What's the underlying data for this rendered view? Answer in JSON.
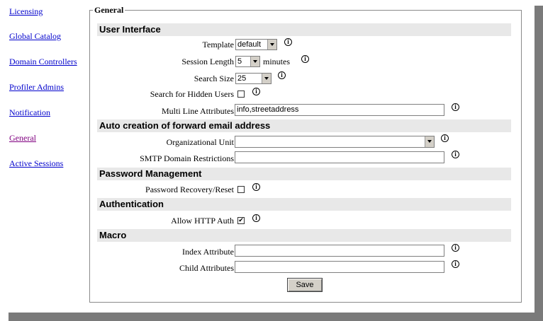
{
  "nav": {
    "items": [
      {
        "label": "Licensing"
      },
      {
        "label": "Global Catalog"
      },
      {
        "label": "Domain Controllers"
      },
      {
        "label": "Profiler Admins"
      },
      {
        "label": "Notification"
      },
      {
        "label": "General"
      },
      {
        "label": "Active Sessions"
      }
    ]
  },
  "form": {
    "legend": "General",
    "info_icon": "i",
    "sections": {
      "user_interface": "User Interface",
      "auto_email": "Auto creation of forward email address",
      "password": "Password Management",
      "auth": "Authentication",
      "macro": "Macro"
    },
    "template": {
      "label": "Template",
      "value": "default"
    },
    "session_length": {
      "label": "Session Length",
      "value": "5",
      "unit": "minutes"
    },
    "search_size": {
      "label": "Search Size",
      "value": "25"
    },
    "hidden_users": {
      "label": "Search for Hidden Users",
      "checked": false
    },
    "multi_line": {
      "label": "Multi Line Attributes",
      "value": "info,streetaddress"
    },
    "org_unit": {
      "label": "Organizational Unit",
      "value": ""
    },
    "smtp": {
      "label": "SMTP Domain Restrictions",
      "value": ""
    },
    "password_recovery": {
      "label": "Password Recovery/Reset",
      "checked": false
    },
    "http_auth": {
      "label": "Allow HTTP Auth",
      "checked": true,
      "mark": "✔"
    },
    "index_attr": {
      "label": "Index Attribute",
      "value": ""
    },
    "child_attr": {
      "label": "Child Attributes",
      "value": ""
    },
    "save_label": "Save"
  },
  "colors": {
    "link": "#0000cc",
    "visited_link": "#800080",
    "section_bg": "#e8e8e8",
    "shadow": "#7a7a7a"
  }
}
